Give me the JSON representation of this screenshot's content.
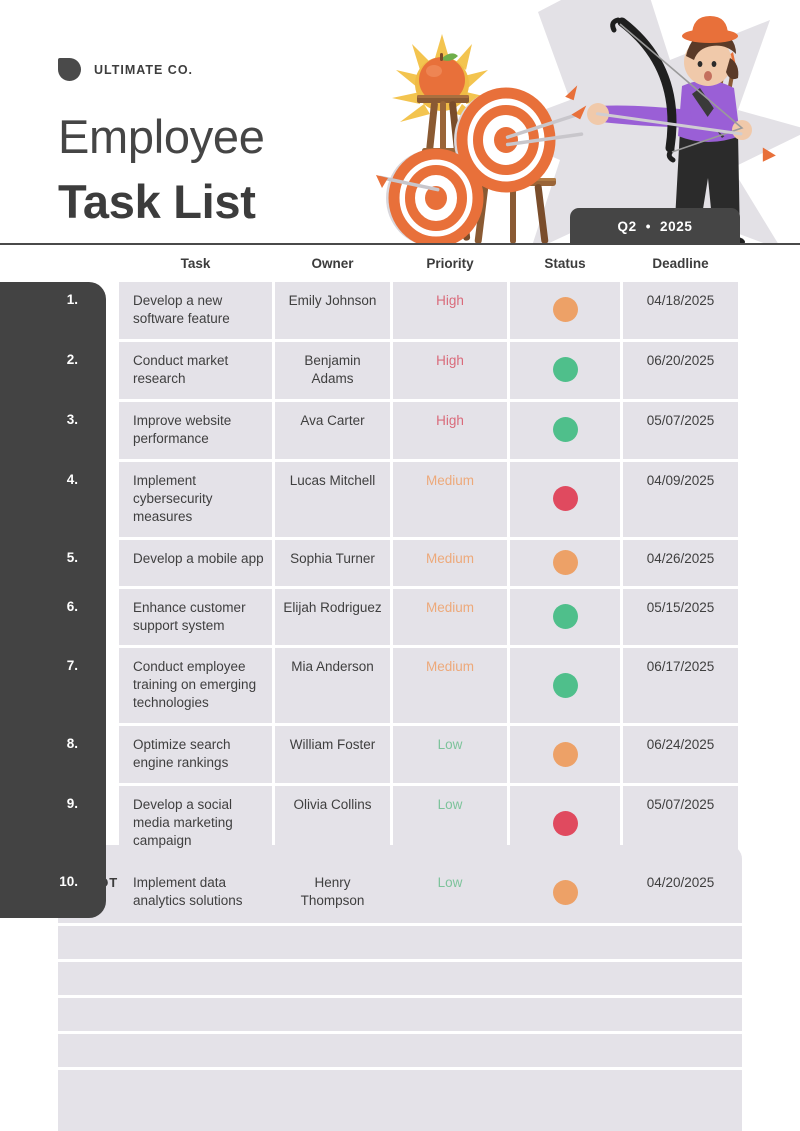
{
  "brand": {
    "name": "ULTIMATE CO.",
    "mark_icon": "leaf-mark-icon",
    "mark_color": "#4a4a4a"
  },
  "title": {
    "line1": "Employee",
    "line2": "Task List"
  },
  "quarter_badge": {
    "quarter": "Q2",
    "separator": "•",
    "year": "2025",
    "background": "#454545",
    "text_color": "#ffffff"
  },
  "illustration": {
    "name": "archery-3d-illustration",
    "elements": [
      "star-background",
      "sun-burst",
      "apple",
      "wooden-easel",
      "target-board-large",
      "target-board-small",
      "arrows",
      "archer-character",
      "bow"
    ],
    "colors": {
      "star": "#e3e1e6",
      "sun": "#f3c44f",
      "apple": "#e8703a",
      "wood": "#8a5a33",
      "target_ring": "#e8703a",
      "shirt": "#9a5fd6",
      "hat": "#e8703a",
      "pants": "#2b2b2b",
      "hair": "#5a3a28"
    }
  },
  "table": {
    "columns": [
      "Task",
      "Owner",
      "Priority",
      "Status",
      "Deadline"
    ],
    "row_background": "#e4e2e8",
    "index_panel_color": "#434343",
    "priority_colors": {
      "High": "#d96a7a",
      "Medium": "#eda97a",
      "Low": "#7dc39b"
    },
    "status_colors": {
      "orange": "#eda167",
      "green": "#4fbf8b",
      "red": "#e04a5f"
    },
    "rows": [
      {
        "num": "1.",
        "task": "Develop a new software feature",
        "owner": "Emily Johnson",
        "priority": "High",
        "status": "orange",
        "deadline": "04/18/2025"
      },
      {
        "num": "2.",
        "task": "Conduct market research",
        "owner": "Benjamin Adams",
        "priority": "High",
        "status": "green",
        "deadline": "06/20/2025"
      },
      {
        "num": "3.",
        "task": "Improve website performance",
        "owner": "Ava Carter",
        "priority": "High",
        "status": "green",
        "deadline": "05/07/2025"
      },
      {
        "num": "4.",
        "task": "Implement cybersecurity measures",
        "owner": "Lucas Mitchell",
        "priority": "Medium",
        "status": "red",
        "deadline": "04/09/2025"
      },
      {
        "num": "5.",
        "task": "Develop a mobile app",
        "owner": "Sophia Turner",
        "priority": "Medium",
        "status": "orange",
        "deadline": "04/26/2025"
      },
      {
        "num": "6.",
        "task": "Enhance customer support system",
        "owner": "Elijah Rodriguez",
        "priority": "Medium",
        "status": "green",
        "deadline": "05/15/2025"
      },
      {
        "num": "7.",
        "task": "Conduct employee training on emerging technologies",
        "owner": "Mia Anderson",
        "priority": "Medium",
        "status": "green",
        "deadline": "06/17/2025"
      },
      {
        "num": "8.",
        "task": "Optimize search engine rankings",
        "owner": "William Foster",
        "priority": "Low",
        "status": "orange",
        "deadline": "06/24/2025"
      },
      {
        "num": "9.",
        "task": "Develop a social media marketing campaign",
        "owner": "Olivia Collins",
        "priority": "Low",
        "status": "red",
        "deadline": "05/07/2025"
      },
      {
        "num": "10.",
        "task": "Implement data analytics solutions",
        "owner": "Henry Thompson",
        "priority": "Low",
        "status": "orange",
        "deadline": "04/20/2025"
      }
    ]
  },
  "notes": {
    "title": "NOTES",
    "background": "#e4e2e8",
    "line_count": 5
  }
}
